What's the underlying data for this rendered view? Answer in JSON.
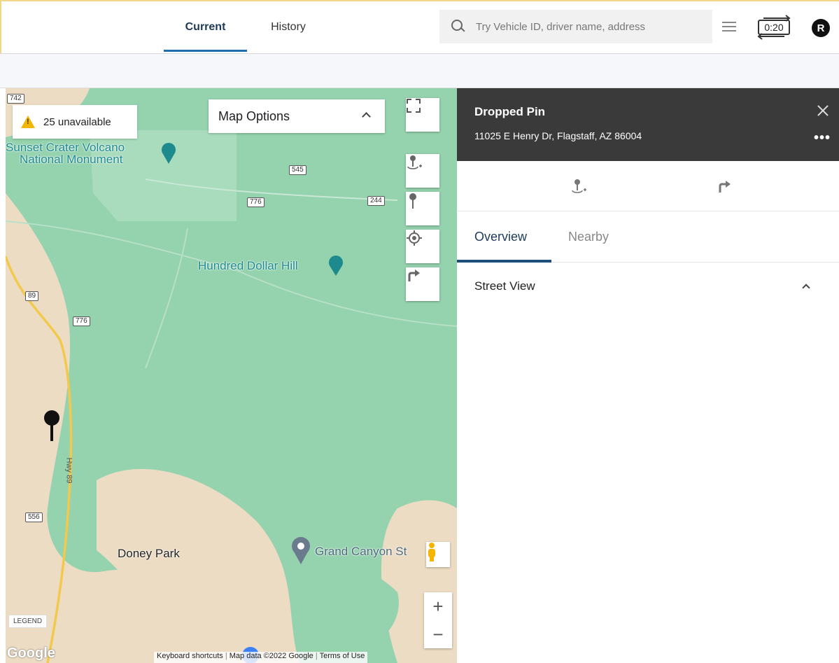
{
  "header": {
    "tabs": [
      {
        "label": "Current",
        "active": true
      },
      {
        "label": "History",
        "active": false
      }
    ],
    "search": {
      "placeholder": "Try Vehicle ID, driver name, address",
      "value": ""
    },
    "refresh_timer": "0:20",
    "avatar_initial": "R"
  },
  "map": {
    "unavailable_label": "25 unavailable",
    "options_label": "Map Options",
    "labels": {
      "sunset_crater_line1": "Sunset Crater Volcano",
      "sunset_crater_line2": "National Monument",
      "hundred_dollar_hill": "Hundred Dollar Hill",
      "doney_park": "Doney Park",
      "grand_canyon": "Grand Canyon St",
      "hwy_89": "Hwy 89"
    },
    "road_shields": [
      "742",
      "545",
      "776",
      "244",
      "89",
      "776",
      "556"
    ],
    "legend_label": "LEGEND",
    "google_logo": "Google",
    "footer": {
      "shortcuts": "Keyboard shortcuts",
      "map_data": "Map data ©2022 Google",
      "terms": "Terms of Use"
    },
    "zoom_in": "+",
    "zoom_out": "−"
  },
  "panel": {
    "title": "Dropped Pin",
    "address": "11025 E Henry Dr, Flagstaff, AZ 86004",
    "more": "•••",
    "tabs": [
      {
        "label": "Overview",
        "active": true
      },
      {
        "label": "Nearby",
        "active": false
      }
    ],
    "section_label": "Street View"
  },
  "colors": {
    "accent": "#1f6fb0",
    "map_green": "#95d2ae",
    "map_tan": "#ecdcc4",
    "panel_header": "#3a3a3a",
    "highway": "#f2c94c"
  }
}
